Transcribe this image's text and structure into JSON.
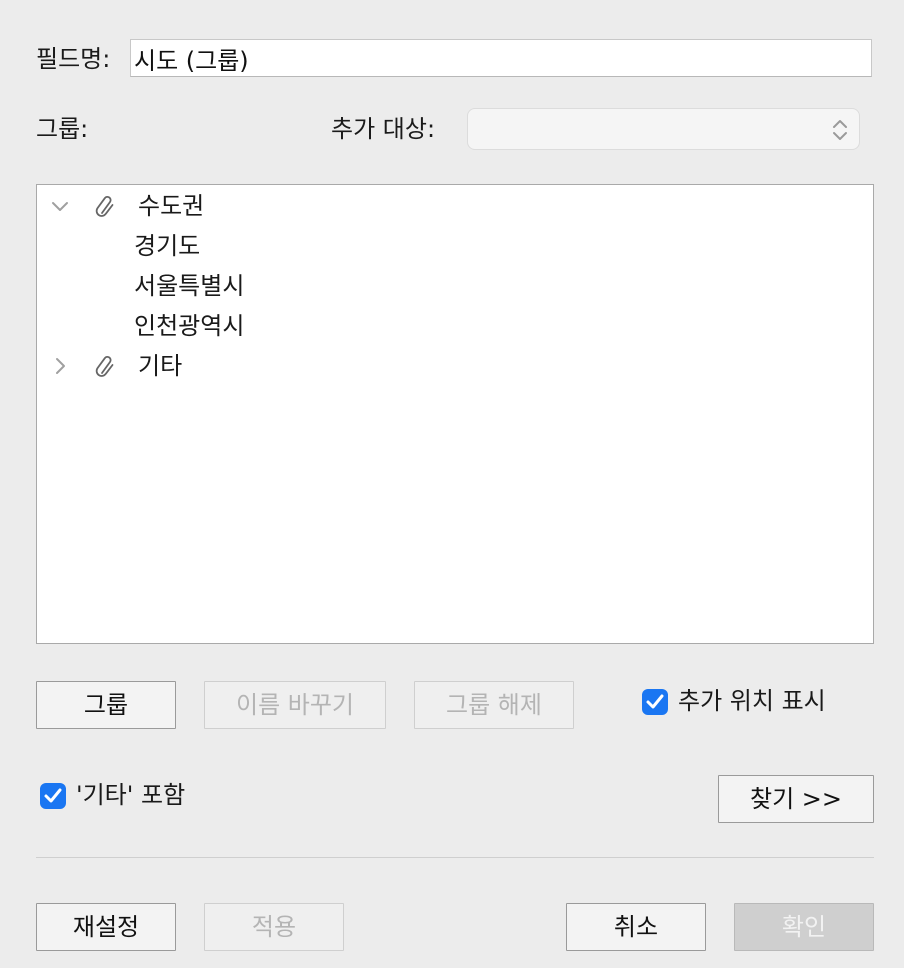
{
  "field_name": {
    "label": "필드명:",
    "value": "시도 (그룹)"
  },
  "group_label": "그룹:",
  "add_target": {
    "label": "추가 대상:",
    "value": ""
  },
  "tree": {
    "items": [
      {
        "label": "수도권",
        "expanded": true,
        "icon": "paperclip-icon"
      },
      {
        "label": "경기도"
      },
      {
        "label": "서울특별시"
      },
      {
        "label": "인천광역시"
      },
      {
        "label": "기타",
        "expanded": false,
        "icon": "paperclip-icon"
      }
    ]
  },
  "buttons": {
    "group": "그룹",
    "rename": "이름 바꾸기",
    "ungroup": "그룹 해제",
    "find": "찾기 >>",
    "reset": "재설정",
    "apply": "적용",
    "cancel": "취소",
    "ok": "확인"
  },
  "checkboxes": {
    "show_add_location": {
      "label": "추가 위치 표시",
      "checked": true
    },
    "include_other": {
      "label": "'기타' 포함",
      "checked": true
    }
  },
  "colors": {
    "accent": "#1a76f2",
    "background": "#ececec"
  }
}
